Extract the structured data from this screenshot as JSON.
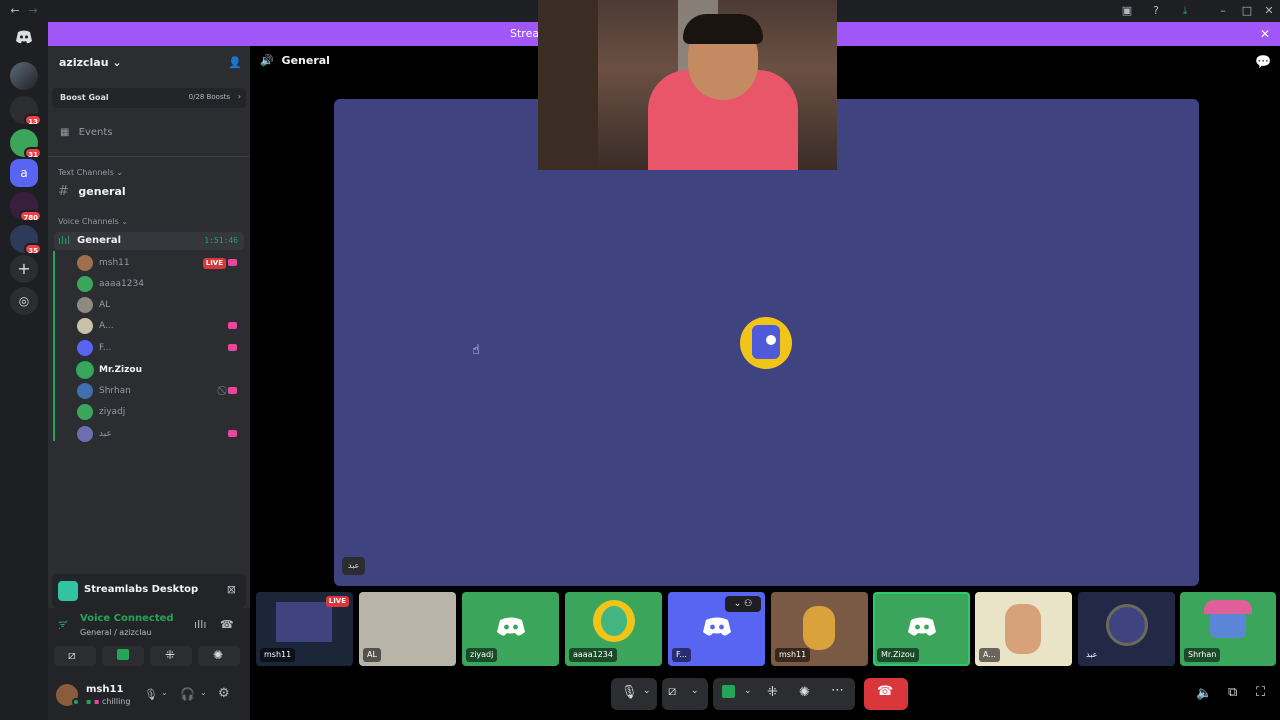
{
  "banner": {
    "text": "Stream"
  },
  "servers": {
    "badges": [
      "13",
      "31",
      "780",
      "35"
    ]
  },
  "guild": {
    "name": "azizclau"
  },
  "boost": {
    "label": "Boost Goal",
    "count": "0/28 Boosts"
  },
  "events_label": "Events",
  "text_channels": {
    "header": "Text Channels",
    "general": "general"
  },
  "voice_channels": {
    "header": "Voice Channels",
    "general": "General",
    "timer": "1:51:46"
  },
  "members": [
    {
      "name": "msh11",
      "live": "LIVE"
    },
    {
      "name": "aaaa1234"
    },
    {
      "name": "AL"
    },
    {
      "name": "A..."
    },
    {
      "name": "F..."
    },
    {
      "name": "Mr.Zizou"
    },
    {
      "name": "Shrhan"
    },
    {
      "name": "ziyadj"
    },
    {
      "name": "عبد"
    }
  ],
  "streamlabs": {
    "title": "Streamlabs Desktop"
  },
  "voice_status": {
    "title": "Voice Connected",
    "sub": "General / azizclau"
  },
  "user": {
    "name": "msh11",
    "status": "chilling"
  },
  "main": {
    "channel": "General",
    "stage_tag": "عبد"
  },
  "tiles": [
    {
      "label": "msh11",
      "live": "LIVE",
      "color": "#1b2638"
    },
    {
      "label": "AL",
      "color": "#b8b4a8"
    },
    {
      "label": "ziyadj",
      "color": "#3ba55c"
    },
    {
      "label": "aaaa1234",
      "color": "#3ba55c"
    },
    {
      "label": "F...",
      "color": "#5865f2"
    },
    {
      "label": "msh11",
      "color": "#7a5a44"
    },
    {
      "label": "Mr.Zizou",
      "color": "#3ba55c"
    },
    {
      "label": "A...",
      "color": "#e9e3c8"
    },
    {
      "label": "عبد",
      "color": "#232846"
    },
    {
      "label": "Shrhan",
      "color": "#3ba55c"
    }
  ],
  "colors": {
    "blurple": "#5865f2",
    "banner": "#a156f7",
    "green": "#23a55a",
    "red": "#da373c",
    "stage": "#3f4480"
  }
}
